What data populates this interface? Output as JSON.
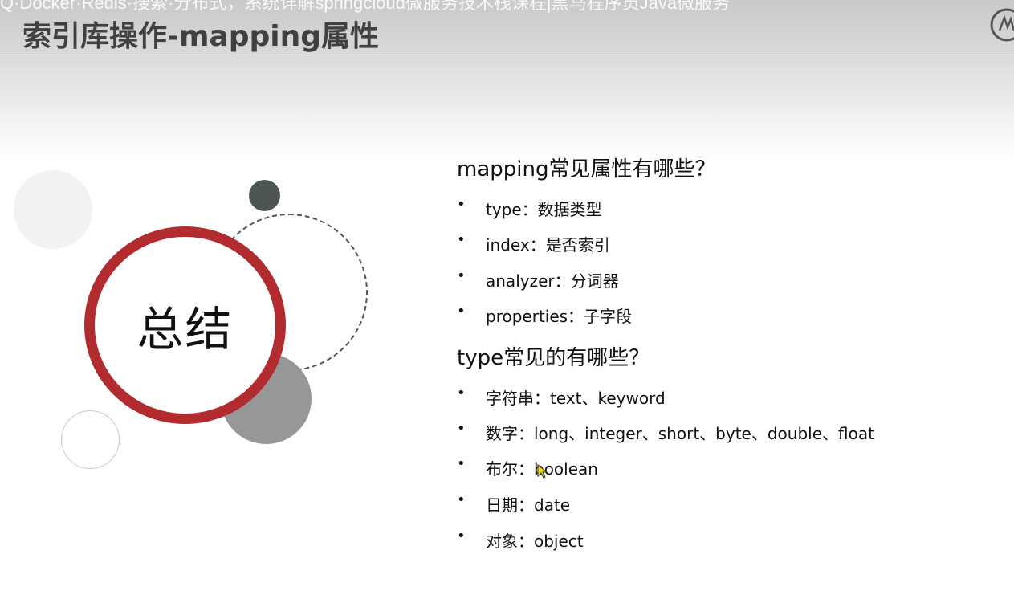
{
  "overlay_caption": "Q·Docker·Redis·搜索·分布式，系统详解springcloud微服务技术栈课程|黑马程序员Java微服务",
  "slide_title": "索引库操作-mapping属性",
  "summary_label": "总结",
  "section1": {
    "heading": "mapping常见属性有哪些？",
    "items": [
      "type：数据类型",
      "index：是否索引",
      "analyzer：分词器",
      "properties：子字段"
    ]
  },
  "section2": {
    "heading": "type常见的有哪些？",
    "items": [
      "字符串：text、keyword",
      "数字：long、integer、short、byte、double、float",
      "布尔：boolean",
      "日期：date",
      "对象：object"
    ]
  },
  "bullet_glyph": "•",
  "colors": {
    "ring_red": "#b22b2e",
    "title_gray": "#404040",
    "dark_dot": "#4d5552",
    "gray_circle": "#979797"
  },
  "icons": {
    "logo": "heima-logo-icon",
    "cursor": "mouse-pointer-icon"
  }
}
